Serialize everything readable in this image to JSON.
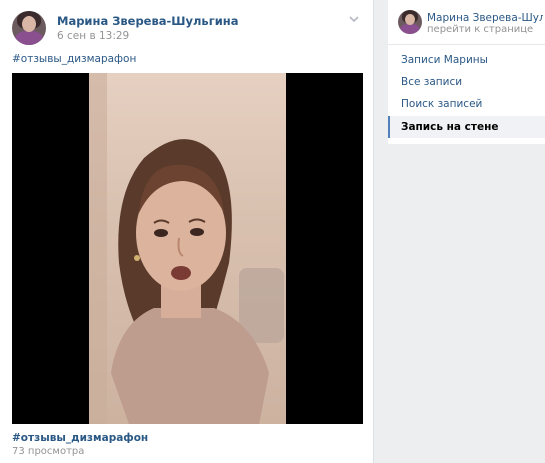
{
  "post": {
    "author": "Марина Зверева-Шульгина",
    "date": "6 сен в 13:29",
    "hashtag_top": "#отзывы_дизмарафон",
    "hashtag_bottom": "#отзывы_дизмарафон",
    "views": "73 просмотра",
    "menu_icon": "chevron-down-icon"
  },
  "sidebar": {
    "author": "Марина Зверева-Шульгина",
    "goto_page": "перейти к странице",
    "items": [
      {
        "label": "Записи Марины",
        "active": false
      },
      {
        "label": "Все записи",
        "active": false
      },
      {
        "label": "Поиск записей",
        "active": false
      },
      {
        "label": "Запись на стене",
        "active": true
      }
    ]
  },
  "colors": {
    "link": "#2a5885",
    "muted": "#939393",
    "background": "#edeef0",
    "active_marker": "#5181b8"
  }
}
